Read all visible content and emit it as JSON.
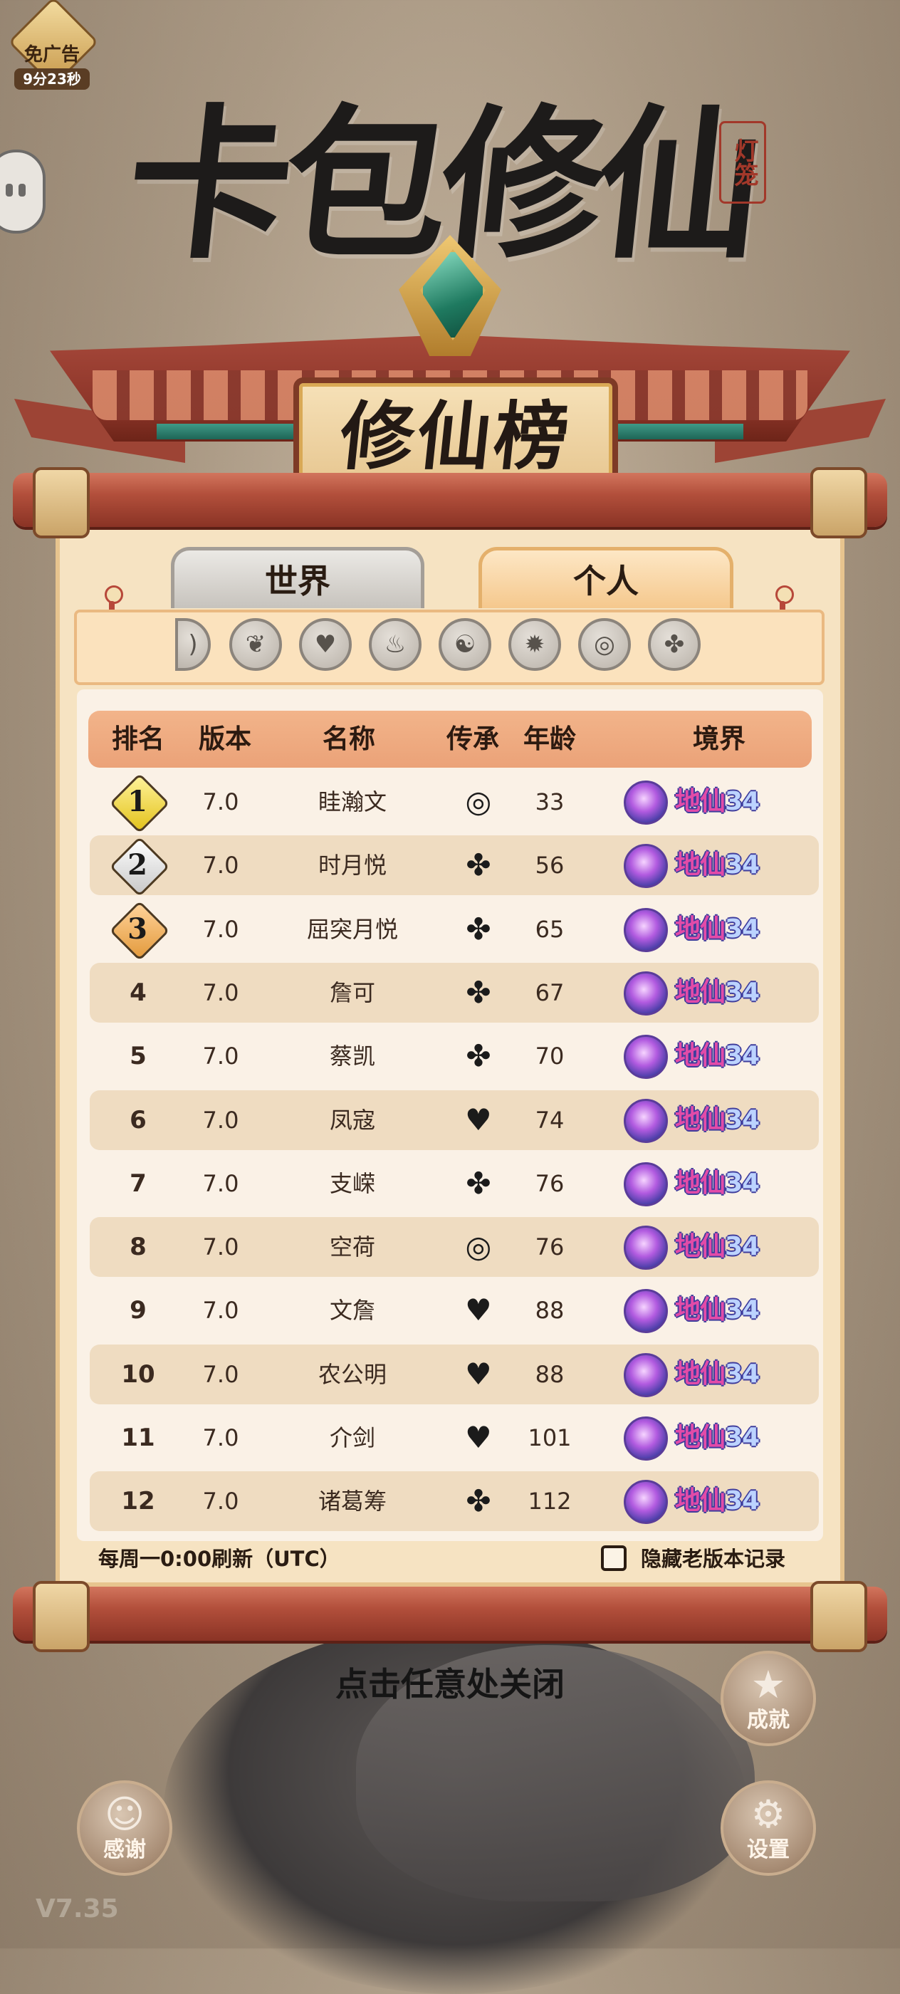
{
  "ad_badge": {
    "label": "免广告",
    "timer": "9分23秒"
  },
  "title": {
    "game_name": "卡包修仙",
    "seal": "灯笼",
    "board": "修仙榜"
  },
  "tabs": [
    {
      "label": "世界",
      "active": false
    },
    {
      "label": "个人",
      "active": true
    }
  ],
  "faction_icons": [
    "faction-icon-partial",
    "wings-icon",
    "heart-icon",
    "flame-icon",
    "yin-yang-icon",
    "fire-spirit-icon",
    "ring-icon",
    "sword-swirl-icon"
  ],
  "table": {
    "headers": {
      "rank": "排名",
      "version": "版本",
      "name": "名称",
      "inheritance": "传承",
      "age": "年龄",
      "realm": "境界"
    },
    "rows": [
      {
        "rank": "1",
        "version": "7.0",
        "name": "眭瀚文",
        "inheritance": "ring-icon",
        "age": "33",
        "realm": "地仙",
        "level": "34"
      },
      {
        "rank": "2",
        "version": "7.0",
        "name": "时月悦",
        "inheritance": "sword-swirl-icon",
        "age": "56",
        "realm": "地仙",
        "level": "34"
      },
      {
        "rank": "3",
        "version": "7.0",
        "name": "屈突月悦",
        "inheritance": "sword-swirl-icon",
        "age": "65",
        "realm": "地仙",
        "level": "34"
      },
      {
        "rank": "4",
        "version": "7.0",
        "name": "詹可",
        "inheritance": "sword-swirl-icon",
        "age": "67",
        "realm": "地仙",
        "level": "34"
      },
      {
        "rank": "5",
        "version": "7.0",
        "name": "蔡凯",
        "inheritance": "sword-swirl-icon",
        "age": "70",
        "realm": "地仙",
        "level": "34"
      },
      {
        "rank": "6",
        "version": "7.0",
        "name": "凤寇",
        "inheritance": "heart-icon",
        "age": "74",
        "realm": "地仙",
        "level": "34"
      },
      {
        "rank": "7",
        "version": "7.0",
        "name": "支嵘",
        "inheritance": "sword-swirl-icon",
        "age": "76",
        "realm": "地仙",
        "level": "34"
      },
      {
        "rank": "8",
        "version": "7.0",
        "name": "空荷",
        "inheritance": "ring-icon",
        "age": "76",
        "realm": "地仙",
        "level": "34"
      },
      {
        "rank": "9",
        "version": "7.0",
        "name": "文詹",
        "inheritance": "heart-icon",
        "age": "88",
        "realm": "地仙",
        "level": "34"
      },
      {
        "rank": "10",
        "version": "7.0",
        "name": "农公明",
        "inheritance": "heart-icon",
        "age": "88",
        "realm": "地仙",
        "level": "34"
      },
      {
        "rank": "11",
        "version": "7.0",
        "name": "介剑",
        "inheritance": "heart-icon",
        "age": "101",
        "realm": "地仙",
        "level": "34"
      },
      {
        "rank": "12",
        "version": "7.0",
        "name": "诸葛筹",
        "inheritance": "sword-swirl-icon",
        "age": "112",
        "realm": "地仙",
        "level": "34"
      }
    ]
  },
  "footer": {
    "refresh_note": "每周一0:00刷新（UTC）",
    "hide_old_label": "隐藏老版本记录",
    "hide_old_checked": false
  },
  "close_hint": "点击任意处关闭",
  "buttons": {
    "achievement": "成就",
    "thanks": "感谢",
    "settings": "设置"
  },
  "version": "V7.35",
  "colors": {
    "rod_red": "#b24f3b",
    "panel_cream": "#f6e3c2",
    "header_peach": "#eba278",
    "realm_pink": "#e24ba8"
  }
}
